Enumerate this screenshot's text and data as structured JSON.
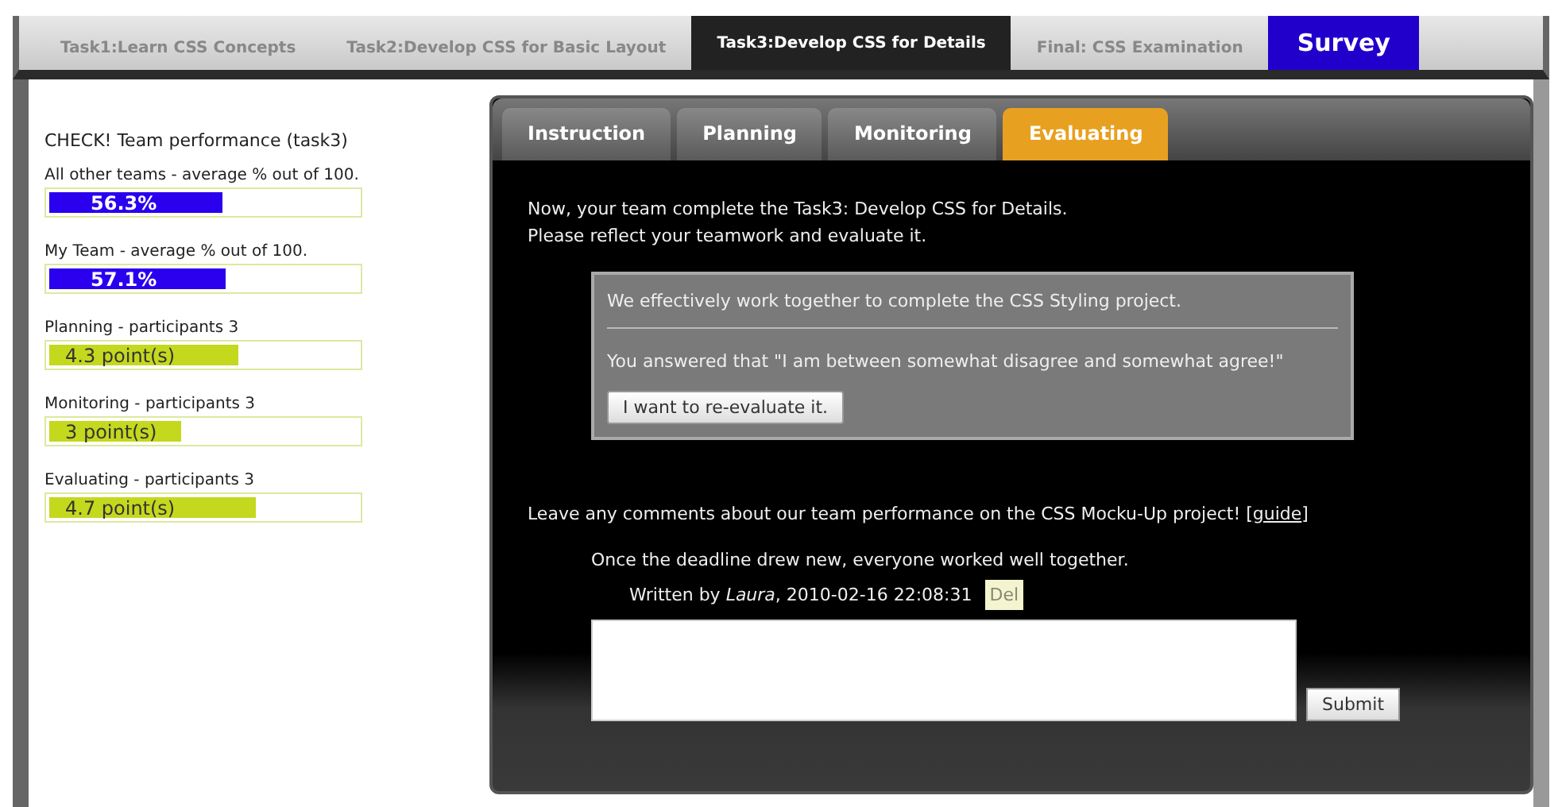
{
  "top_tabs": [
    {
      "label": "Task1:Learn CSS Concepts",
      "selected": false,
      "kind": "task"
    },
    {
      "label": "Task2:Develop CSS for Basic Layout",
      "selected": false,
      "kind": "task"
    },
    {
      "label": "Task3:Develop CSS for Details",
      "selected": true,
      "kind": "task"
    },
    {
      "label": "Final: CSS Examination",
      "selected": false,
      "kind": "task"
    },
    {
      "label": "Survey",
      "selected": false,
      "kind": "survey"
    }
  ],
  "sidebar": {
    "title": "CHECK! Team performance (task3)",
    "meters": [
      {
        "label": "All other teams - average % out of 100.",
        "reading": "56.3%",
        "level": 0.563,
        "kind": "percent"
      },
      {
        "label": "My Team - average % out of 100.",
        "reading": "57.1%",
        "level": 0.571,
        "kind": "percent"
      },
      {
        "label": "Planning - participants 3",
        "reading": "4.3 point(s)",
        "level": 0.614,
        "kind": "points"
      },
      {
        "label": "Monitoring - participants 3",
        "reading": "3 point(s)",
        "level": 0.429,
        "kind": "points"
      },
      {
        "label": "Evaluating - participants 3",
        "reading": "4.7 point(s)",
        "level": 0.671,
        "kind": "points"
      }
    ]
  },
  "panel": {
    "tabs": [
      {
        "label": "Instruction",
        "selected": false
      },
      {
        "label": "Planning",
        "selected": false
      },
      {
        "label": "Monitoring",
        "selected": false
      },
      {
        "label": "Evaluating",
        "selected": true
      }
    ],
    "intro": [
      "Now, your team complete the Task3: Develop CSS for Details.",
      "Please reflect your teamwork and evaluate it."
    ],
    "evaluation": {
      "statement": "We effectively work together to complete the CSS Styling project.",
      "answer": "You answered that \"I am between somewhat disagree and somewhat agree!\"",
      "button": "I want to re-evaluate it."
    },
    "comments_prompt": {
      "before": "Leave any comments about our team performance on the CSS Mocku-Up project! [",
      "link": "guide",
      "after": "]"
    },
    "comments": [
      {
        "text": "Once the deadline drew new, everyone worked well together.",
        "byline": "Written by *Laura*, 2010-02-16 22:08:31",
        "delete": "Del"
      }
    ],
    "submit": "Submit"
  }
}
